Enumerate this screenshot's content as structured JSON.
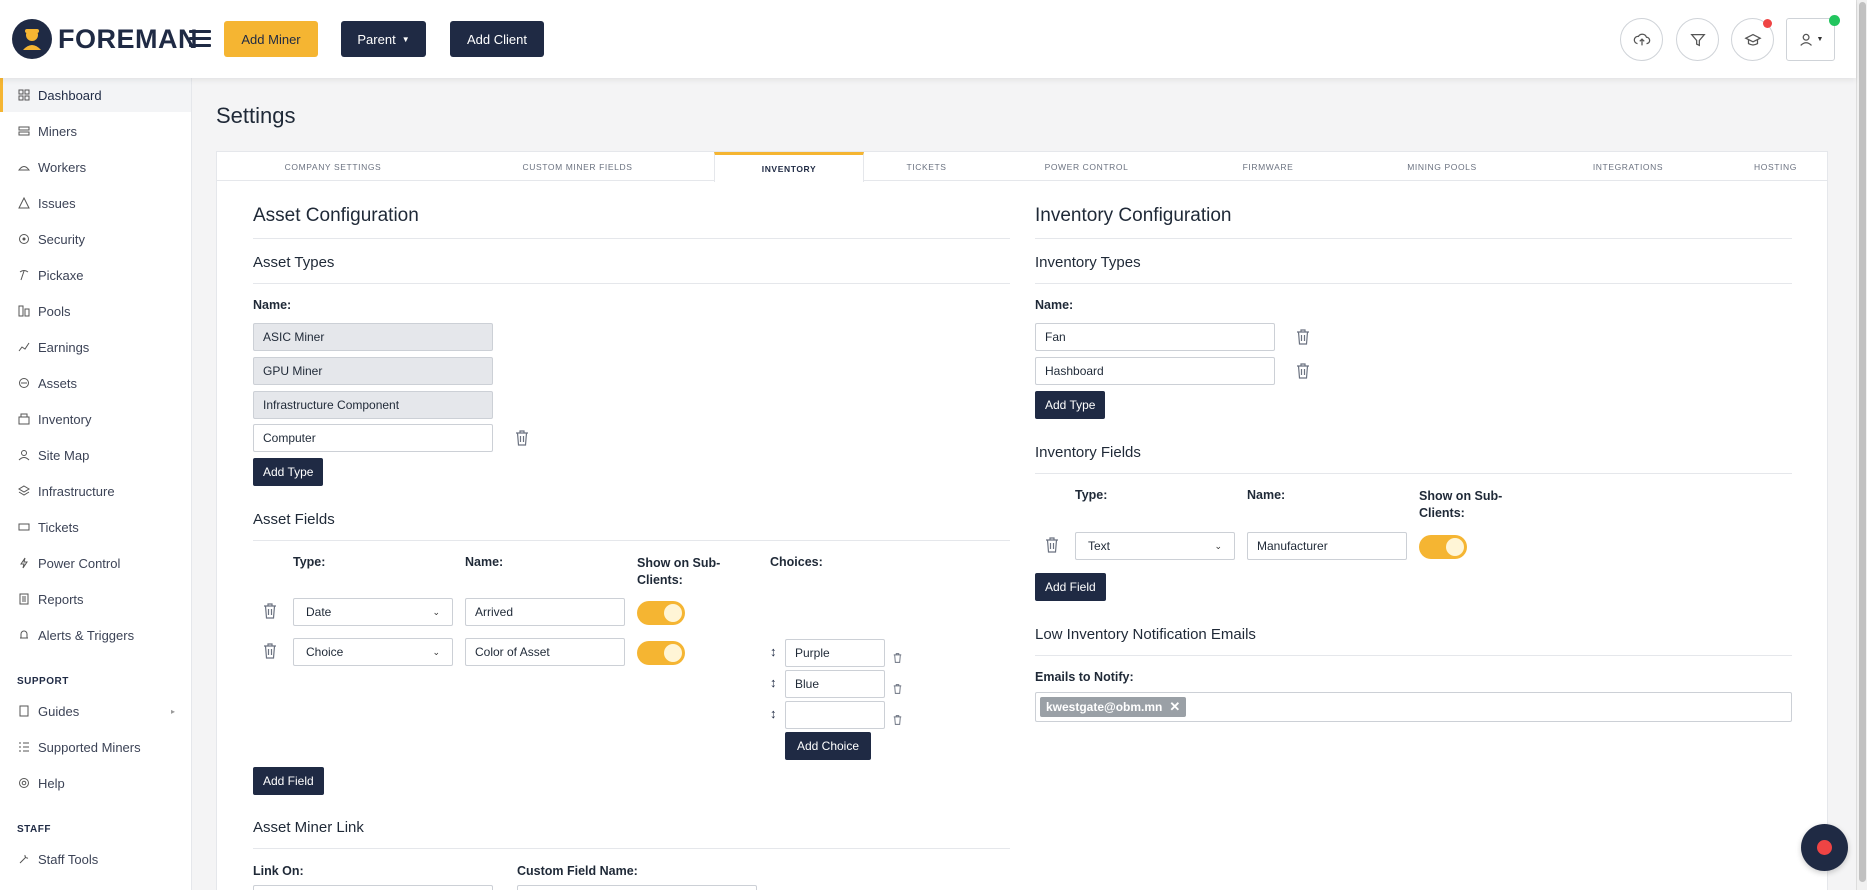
{
  "brand": {
    "name": "FOREMAN"
  },
  "header": {
    "add_miner": "Add Miner",
    "parent": "Parent",
    "add_client": "Add Client"
  },
  "sidebar": {
    "items": [
      {
        "label": "Dashboard",
        "icon": "dashboard-icon"
      },
      {
        "label": "Miners",
        "icon": "server-icon"
      },
      {
        "label": "Workers",
        "icon": "workers-icon"
      },
      {
        "label": "Issues",
        "icon": "warning-icon"
      },
      {
        "label": "Security",
        "icon": "shield-icon"
      },
      {
        "label": "Pickaxe",
        "icon": "pickaxe-icon"
      },
      {
        "label": "Pools",
        "icon": "pools-icon"
      },
      {
        "label": "Earnings",
        "icon": "earnings-icon"
      },
      {
        "label": "Assets",
        "icon": "assets-icon"
      },
      {
        "label": "Inventory",
        "icon": "inventory-icon"
      },
      {
        "label": "Site Map",
        "icon": "sitemap-icon"
      },
      {
        "label": "Infrastructure",
        "icon": "layers-icon"
      },
      {
        "label": "Tickets",
        "icon": "ticket-icon"
      },
      {
        "label": "Power Control",
        "icon": "bolt-icon"
      },
      {
        "label": "Reports",
        "icon": "report-icon"
      },
      {
        "label": "Alerts & Triggers",
        "icon": "alert-icon"
      }
    ],
    "support_heading": "SUPPORT",
    "support_items": [
      {
        "label": "Guides",
        "icon": "book-icon"
      },
      {
        "label": "Supported Miners",
        "icon": "list-icon"
      },
      {
        "label": "Help",
        "icon": "help-icon"
      }
    ],
    "staff_heading": "STAFF",
    "staff_items": [
      {
        "label": "Staff Tools",
        "icon": "tools-icon"
      }
    ]
  },
  "page": {
    "title": "Settings"
  },
  "tabs": [
    "COMPANY SETTINGS",
    "CUSTOM MINER FIELDS",
    "INVENTORY",
    "TICKETS",
    "POWER CONTROL",
    "FIRMWARE",
    "MINING POOLS",
    "INTEGRATIONS",
    "HOSTING"
  ],
  "asset": {
    "title": "Asset Configuration",
    "types_title": "Asset Types",
    "name_label": "Name:",
    "types": [
      "ASIC Miner",
      "GPU Miner",
      "Infrastructure Component",
      "Computer"
    ],
    "add_type": "Add Type",
    "fields_title": "Asset Fields",
    "col_type": "Type:",
    "col_name": "Name:",
    "col_show": "Show on Sub-Clients:",
    "col_choices": "Choices:",
    "fields": [
      {
        "type": "Date",
        "name": "Arrived",
        "show": true
      },
      {
        "type": "Choice",
        "name": "Color of Asset",
        "show": true
      }
    ],
    "choices": [
      "Purple",
      "Blue",
      ""
    ],
    "add_choice": "Add Choice",
    "add_field": "Add Field",
    "link_title": "Asset Miner Link",
    "link_on": "Link On:",
    "custom_field_name": "Custom Field Name:"
  },
  "inventory": {
    "title": "Inventory Configuration",
    "types_title": "Inventory Types",
    "name_label": "Name:",
    "types": [
      "Fan",
      "Hashboard"
    ],
    "add_type": "Add Type",
    "fields_title": "Inventory Fields",
    "col_type": "Type:",
    "col_name": "Name:",
    "col_show": "Show on Sub-Clients:",
    "fields": [
      {
        "type": "Text",
        "name": "Manufacturer",
        "show": true
      }
    ],
    "add_field": "Add Field",
    "low_title": "Low Inventory Notification Emails",
    "emails_label": "Emails to Notify:",
    "emails": [
      "kwestgate@obm.mn"
    ]
  },
  "colors": {
    "accent": "#f5b532",
    "navy": "#1f2a44",
    "notify": "#ef4444",
    "online": "#22c55e"
  }
}
